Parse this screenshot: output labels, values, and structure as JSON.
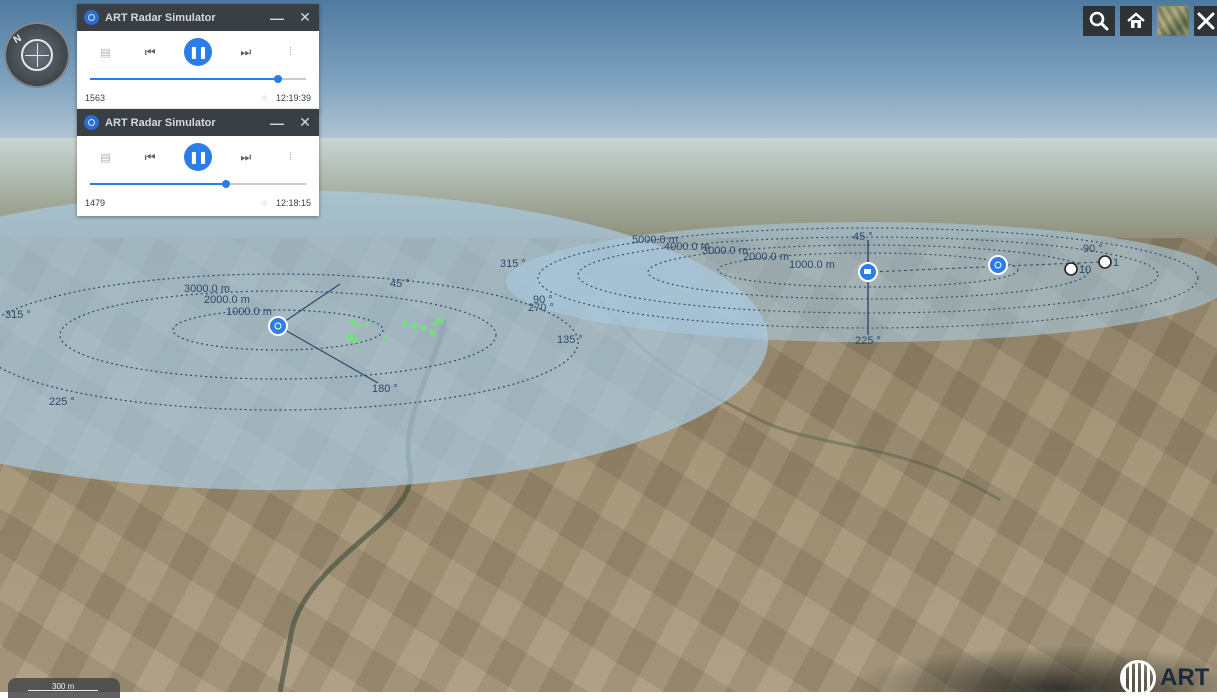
{
  "simulators": [
    {
      "title": "ART Radar Simulator",
      "minimize_glyph": "—",
      "close_glyph": "✕",
      "icons": [
        "layers-icon",
        "skip-back-icon",
        "pause-icon",
        "skip-forward-icon",
        "settings-icon"
      ],
      "progress": 0.87,
      "frame": "1563",
      "time": "12:19:39"
    },
    {
      "title": "ART Radar Simulator",
      "minimize_glyph": "—",
      "close_glyph": "✕",
      "icons": [
        "layers-icon",
        "skip-back-icon",
        "pause-icon",
        "skip-forward-icon",
        "settings-icon"
      ],
      "progress": 0.63,
      "frame": "1479",
      "time": "12:18:15"
    }
  ],
  "compass": {
    "north_label": "N"
  },
  "toolbar": {
    "icons": [
      "search-icon",
      "home-icon",
      "basemap-icon",
      "tools-icon"
    ]
  },
  "scale": {
    "label": "300 m"
  },
  "brand": {
    "text": "ART"
  },
  "radar_left": {
    "range_labels": [
      "3000.0 m",
      "2000.0 m",
      "1000.0 m"
    ],
    "bearing_labels": [
      "315 °",
      "45 °",
      "90 °",
      "270 °",
      "135 °",
      "180 °",
      "225 °"
    ]
  },
  "radar_right": {
    "range_labels": [
      "5000.0 m",
      "4000.0 m",
      "3000.0 m",
      "2000.0 m",
      "1000.0 m"
    ],
    "bearing_labels": [
      "315 °",
      "45 °",
      "90 °",
      "225 °"
    ],
    "track_labels": [
      "10",
      "1"
    ]
  },
  "colors": {
    "accent": "#2b7de9",
    "titlebar": "#3a3f44",
    "radar_fill": "#a9c9df",
    "radar_text": "#2b4a6b",
    "track_green": "#6fe37a"
  }
}
